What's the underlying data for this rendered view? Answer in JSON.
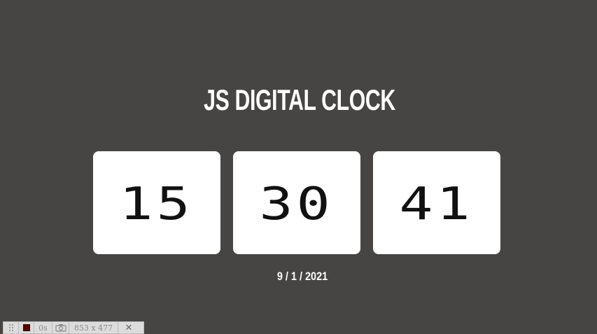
{
  "title": "JS DIGITAL CLOCK",
  "clock": {
    "hours": "15",
    "minutes": "30",
    "seconds": "41"
  },
  "date": "9 / 1 / 2021",
  "toolbar": {
    "grip_icon": "grip-icon",
    "record_icon": "record-stop-icon",
    "elapsed": "0s",
    "camera_icon": "camera-icon",
    "size": "853 x 477",
    "close_icon": "close-icon",
    "close_glyph": "✕"
  },
  "colors": {
    "background": "#464544",
    "card": "#ffffff",
    "digits": "#111111",
    "text": "#ffffff"
  }
}
